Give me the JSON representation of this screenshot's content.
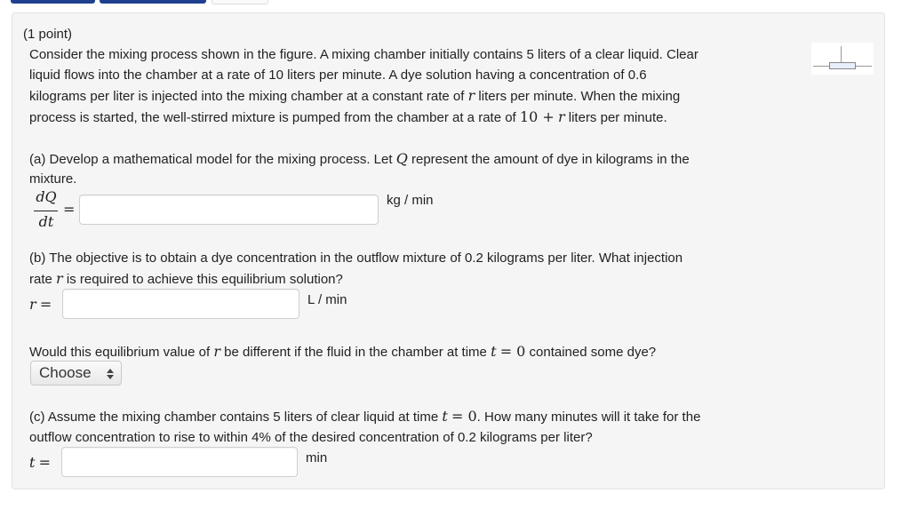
{
  "header": {
    "points": "(1 point)"
  },
  "intro": {
    "lines": [
      "Consider the mixing process shown in the figure. A mixing chamber initially contains 5 liters of a clear liquid. Clear",
      "liquid flows into the chamber at a rate of 10 liters per minute. A dye solution having a concentration of 0.6",
      "kilograms per liter is injected into the mixing chamber at a constant rate of",
      "liters per minute. When the mixing",
      "process is started, the well-stirred mixture is pumped from the chamber at a rate of",
      "liters per minute."
    ],
    "var_r": "r",
    "rate_expr_10": "10 +",
    "rate_expr_r": "r"
  },
  "part_a": {
    "line1_pre": "(a) Develop a mathematical model for the mixing process. Let",
    "var_Q": "Q",
    "line1_post": "represent the amount of dye in kilograms in the",
    "line2": "mixture.",
    "frac_num": "dQ",
    "frac_den": "dt",
    "equals": "=",
    "unit": "kg / min",
    "value": ""
  },
  "part_b": {
    "line1": "(b) The objective is to obtain a dye concentration in the outflow mixture of 0.2 kilograms per liter. What injection",
    "line2_pre": "rate",
    "var_r": "r",
    "line2_post": "is required to achieve this equilibrium solution?",
    "label_var": "r",
    "label_eq": "=",
    "unit": "L / min",
    "value": ""
  },
  "question": {
    "pre": "Would this equilibrium value of",
    "var_r": "r",
    "mid": "be different if the fluid in the chamber at time",
    "var_t": "t",
    "eq": "= 0",
    "post": "contained some dye?",
    "select_label": "Choose"
  },
  "part_c": {
    "line1_pre": "(c) Assume the mixing chamber contains 5 liters of clear liquid at time",
    "var_t": "t",
    "eq": "= 0",
    "line1_post": ". How many minutes will it take for the",
    "line2": "outflow concentration to rise to within 4% of the desired concentration of 0.2 kilograms per liter?",
    "label_var": "t",
    "label_eq": "=",
    "unit": "min",
    "value": ""
  },
  "colors": {
    "tab": "#1f3f8f",
    "panel": "#f5f5f5",
    "border": "#e3e3e3"
  },
  "figure_icon": "mixing-chamber-figure"
}
